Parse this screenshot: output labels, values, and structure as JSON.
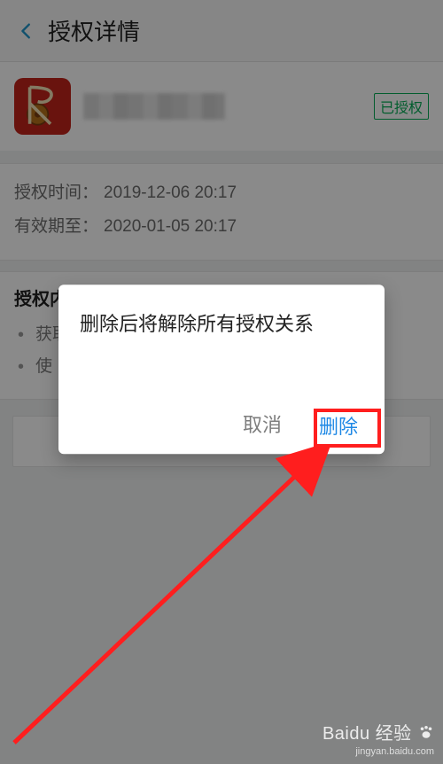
{
  "header": {
    "title": "授权详情"
  },
  "app": {
    "badge": "已授权"
  },
  "info": {
    "auth_time_label": "授权时间：",
    "auth_time_value": "2019-12-06 20:17",
    "valid_until_label": "有效期至：",
    "valid_until_value": "2020-01-05 20:17"
  },
  "content": {
    "title": "授权内容：",
    "items": [
      "获取你的公开信息(昵称、头像、性别等)",
      "使"
    ]
  },
  "dialog": {
    "message": "删除后将解除所有授权关系",
    "cancel": "取消",
    "delete": "删除"
  },
  "watermark": {
    "brand": "Baidu 经验",
    "sub": "jingyan.baidu.com"
  }
}
